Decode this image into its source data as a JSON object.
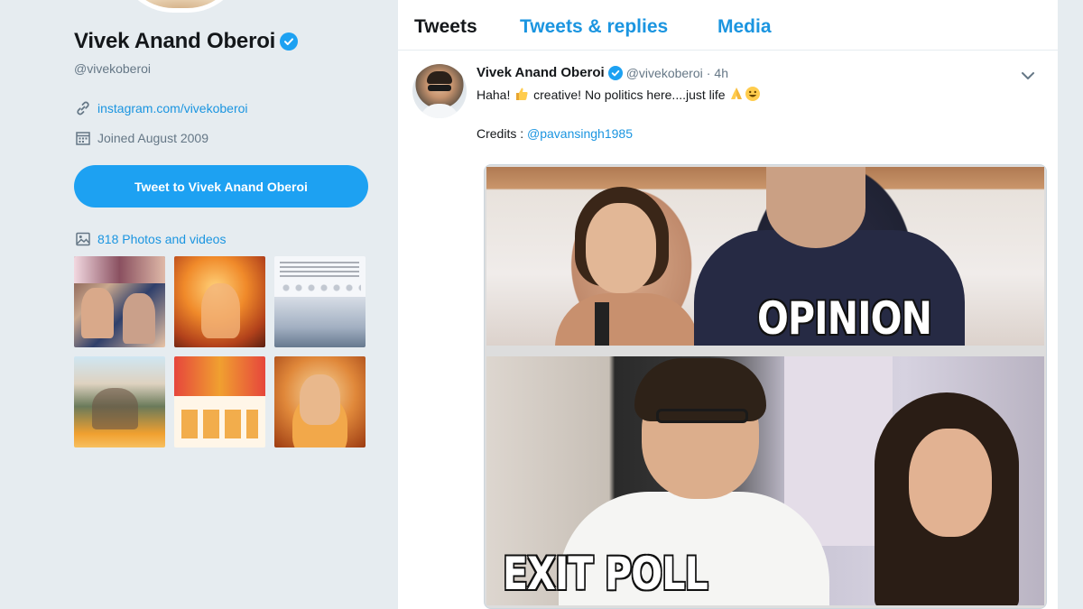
{
  "profile": {
    "name": "Vivek Anand Oberoi",
    "handle": "@vivekoberoi",
    "website": "instagram.com/vivekoberoi",
    "joined": "Joined August 2009",
    "tweet_to_label": "Tweet to Vivek Anand Oberoi",
    "media_count_label": "818 Photos and videos",
    "icons": [
      "link-icon",
      "calendar-icon",
      "photo-icon",
      "verified-badge-icon"
    ]
  },
  "tabs": [
    {
      "label": "Tweets",
      "active": true
    },
    {
      "label": "Tweets & replies",
      "active": false
    },
    {
      "label": "Media",
      "active": false
    }
  ],
  "tweet": {
    "author_name": "Vivek Anand Oberoi",
    "author_handle": "@vivekoberoi",
    "separator": "·",
    "time": "4h",
    "text_parts": {
      "pre": "Haha! ",
      "mid": " creative! No politics here....just life ",
      "credits_label": "Credits : ",
      "credits_mention": "@pavansingh1985"
    },
    "emojis": [
      "thumbs-up",
      "folded-hands",
      "grinning-face"
    ],
    "image_captions": {
      "top": "OPINION POLL",
      "bottom": "EXIT POLL"
    }
  },
  "colors": {
    "accent": "#1da1f2",
    "link": "#1b95e0",
    "background": "#e6ecf0",
    "text": "#14171a",
    "muted": "#657786"
  }
}
